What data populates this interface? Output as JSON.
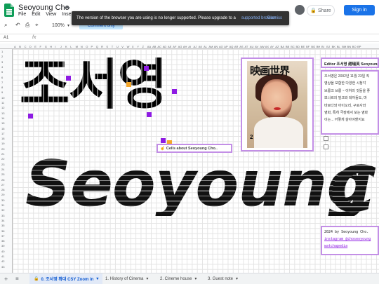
{
  "app": {
    "title": "Seoyoung Cho",
    "menu": [
      "File",
      "Edit",
      "View",
      "Insert"
    ],
    "share_label": "Share",
    "signin_label": "Sign in"
  },
  "notification": {
    "message": "The version of the browser you are using is no longer supported. Please upgrade to a",
    "link": "supported browser",
    "dismiss": "Dismiss"
  },
  "toolbar": {
    "zoom": "100%",
    "mode": "Comment only"
  },
  "formula_bar": {
    "cell_ref": "A1",
    "fx": "fx"
  },
  "columns": [
    "A",
    "B",
    "C",
    "D",
    "E",
    "F",
    "G",
    "H",
    "I",
    "J",
    "K",
    "L",
    "M",
    "N",
    "O",
    "P",
    "Q",
    "R",
    "S",
    "T",
    "U",
    "V",
    "W",
    "X",
    "Y",
    "Z",
    "AA",
    "AB",
    "AC",
    "AD",
    "AE",
    "AF",
    "AG",
    "AH",
    "AI",
    "AJ",
    "AK",
    "AL",
    "AM",
    "AN",
    "AO",
    "AP",
    "AQ",
    "AR",
    "AS",
    "AT",
    "AU",
    "AV",
    "AW",
    "AX",
    "AY",
    "AZ",
    "BA",
    "BB",
    "BC",
    "BD",
    "BE",
    "BF",
    "BG",
    "BH",
    "BI",
    "BJ",
    "BK",
    "BL",
    "BM",
    "BN",
    "BO",
    "BP"
  ],
  "art": {
    "korean_name": "조서영",
    "english_name": "Seoyoung",
    "english_name_cut": "C"
  },
  "magazine": {
    "title": "映画世界",
    "issue": "2"
  },
  "editor_panel": {
    "text": "Editor 조서영 趙瑞英 Seoyoung Cho"
  },
  "bio_panel": {
    "lines": [
      "조서영은 2002년 11월 23일 직",
      "영상을 포함한 다양한 시청각",
      "브롱크 브롱 ~ 이하의 것들을 좋",
      "보나르의 밀크와 레어들도, 마",
      "바로다와 아이오리, 구로사와",
      "영화, 특히 극장에서 보는 영화",
      "이는... 어떻게 살아야할지요"
    ]
  },
  "cells_badge": {
    "label": "Cells about Seoyoung Cho.."
  },
  "credit_panel": {
    "line1": "2024 by Seoyoung Cho.",
    "line2": "instagram @choseoyoung",
    "line3": "watchapedia"
  },
  "tabs": [
    {
      "label": "0. 조서영 확대 CSY Zoom in",
      "active": true
    },
    {
      "label": "1. History of Cinema",
      "active": false
    },
    {
      "label": "2. Cineme house",
      "active": false
    },
    {
      "label": "3. Guest note",
      "active": false
    }
  ]
}
